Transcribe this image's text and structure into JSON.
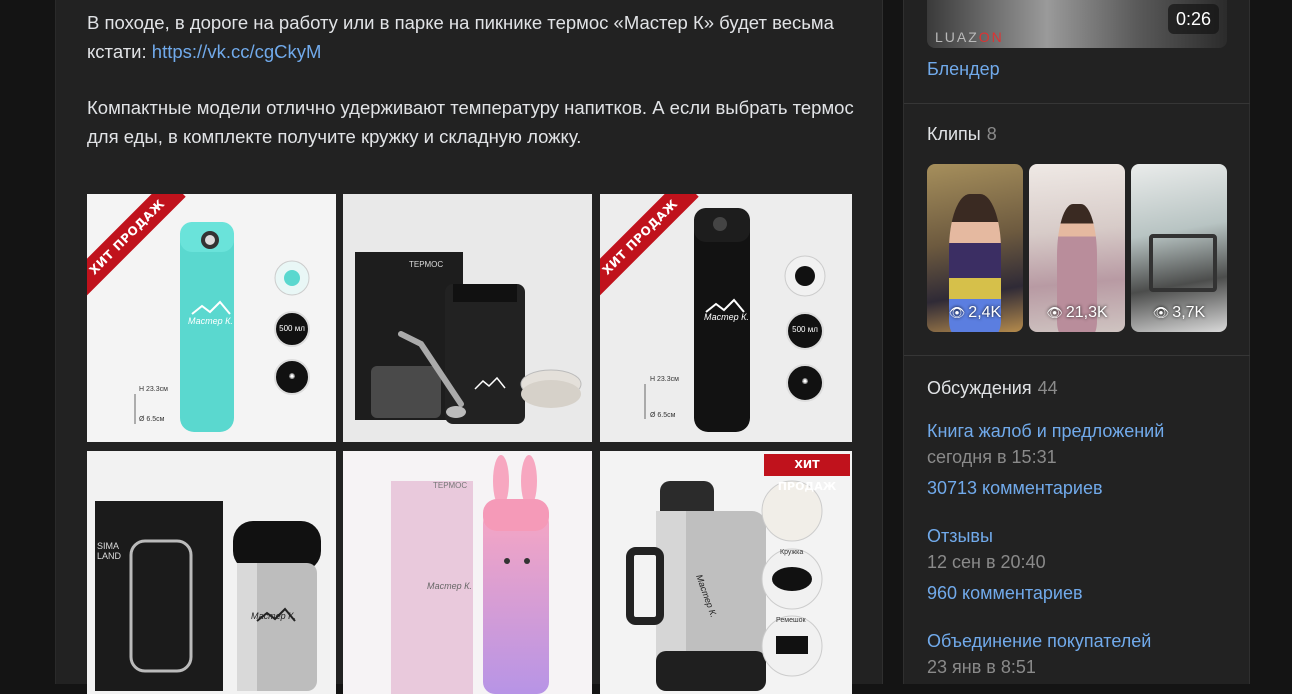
{
  "post": {
    "p1_text": "В походе, в дороге на работу или в парке на пикнике термос «Мастер К» будет весьма кстати: ",
    "p1_link": "https://vk.cc/cgCkyM",
    "p2_text": "Компактные модели отлично удерживают температуру напитков. А если выбрать термос для еды, в комплекте получите кружку и складную ложку.",
    "images": {
      "ribbon": "ХИТ ПРОДАЖ",
      "brand": "Мастер К.",
      "box_label": "ТЕРМОС",
      "dim_h": "H 23.3см",
      "dim_d": "Ø 6.5см",
      "vol_500": "500 мл",
      "cup_label": "Кружка",
      "strap_label": "Ремешок",
      "sima_land": "SIMA LAND"
    }
  },
  "sidebar": {
    "video": {
      "duration": "0:26",
      "title": "Блендер",
      "watermark_a": "LUAZ",
      "watermark_b": "ON"
    },
    "clips": {
      "title": "Клипы",
      "count": "8",
      "items": [
        {
          "views": "2,4K"
        },
        {
          "views": "21,3K"
        },
        {
          "views": "3,7K"
        }
      ]
    },
    "discussions": {
      "title": "Обсуждения",
      "count": "44",
      "items": [
        {
          "title": "Книга жалоб и предложений",
          "date": "сегодня в 15:31",
          "comments": "30713 комментариев"
        },
        {
          "title": "Отзывы",
          "date": "12 сен в 20:40",
          "comments": "960 комментариев"
        },
        {
          "title": "Объединение покупателей",
          "date": "23 янв в 8:51"
        }
      ]
    }
  },
  "colors": {
    "link": "#71aaeb",
    "background": "#141414",
    "panel": "#222222",
    "ribbon": "#c0121c",
    "teal": "#5ad8cf"
  }
}
